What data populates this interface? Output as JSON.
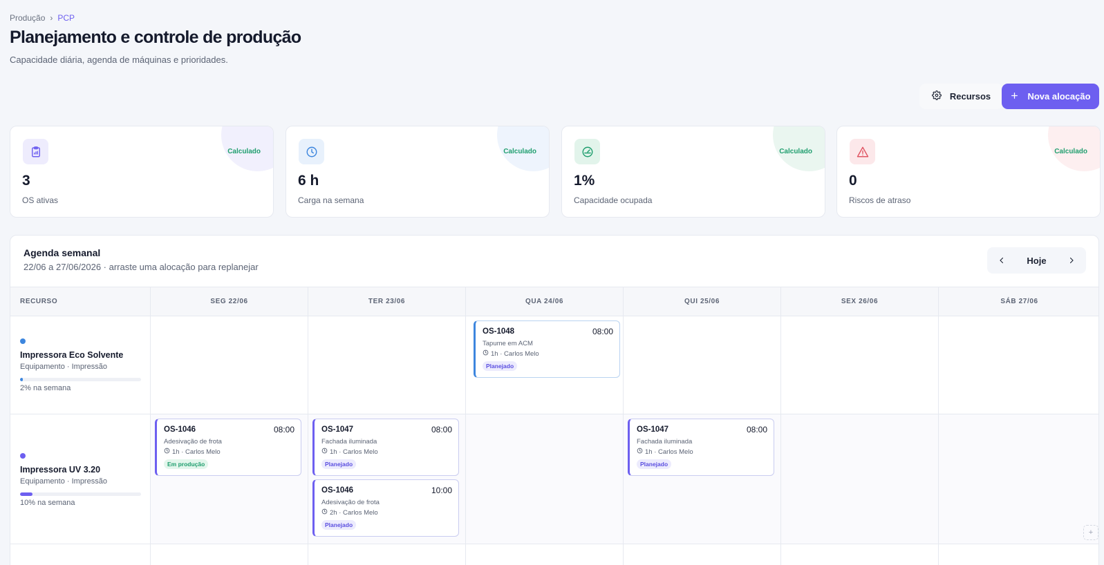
{
  "breadcrumb": {
    "root": "Produção",
    "separator": "›",
    "current": "PCP"
  },
  "header": {
    "title": "Planejamento e controle de produção",
    "subtitle": "Capacidade diária, agenda de máquinas e prioridades."
  },
  "actions": {
    "resources_label": "Recursos",
    "new_allocation_label": "Nova alocação",
    "resources_icon": "gear-icon",
    "new_icon": "plus-icon"
  },
  "kpis": [
    {
      "icon": "clipboard-icon",
      "tag": "Calculado",
      "value": "3",
      "label": "OS ativas",
      "color": "#6d5ff0"
    },
    {
      "icon": "clock-icon",
      "tag": "Calculado",
      "value": "6 h",
      "label": "Carga na semana",
      "color": "#3d86de"
    },
    {
      "icon": "gauge-icon",
      "tag": "Calculado",
      "value": "1%",
      "label": "Capacidade ocupada",
      "color": "#1f9e6e"
    },
    {
      "icon": "warning-icon",
      "tag": "Calculado",
      "value": "0",
      "label": "Riscos de atraso",
      "color": "#e05563"
    }
  ],
  "agenda": {
    "title": "Agenda semanal",
    "subtitle": "22/06 a 27/06/2026 · arraste uma alocação para replanejar",
    "today_label": "Hoje",
    "columns": [
      "RECURSO",
      "SEG 22/06",
      "TER 23/06",
      "QUA 24/06",
      "QUI 25/06",
      "SEX 26/06",
      "SÁB 27/06"
    ],
    "resources": [
      {
        "name": "Impressora Eco Solvente",
        "type": "Equipamento · Impressão",
        "load_label": "2% na semana",
        "load": 0.02,
        "color": "#3d86de"
      },
      {
        "name": "Impressora UV 3.20",
        "type": "Equipamento · Impressão",
        "load_label": "10% na semana",
        "load": 0.1,
        "color": "#6d5ff0"
      }
    ],
    "cards": [
      {
        "os": "OS-1048",
        "time": "08:00",
        "desc": "Tapume em ACM",
        "meta": "1h · Carlos Melo",
        "badge": "Planejado"
      },
      {
        "os": "OS-1046",
        "time": "08:00",
        "desc": "Adesivação de frota",
        "meta": "1h · Carlos Melo",
        "badge": "Em produção"
      },
      {
        "os": "OS-1047",
        "time": "08:00",
        "desc": "Fachada iluminada",
        "meta": "1h · Carlos Melo",
        "badge": "Planejado"
      },
      {
        "os": "OS-1046",
        "time": "10:00",
        "desc": "Adesivação de frota",
        "meta": "2h · Carlos Melo",
        "badge": "Planejado"
      },
      {
        "os": "OS-1047",
        "time": "08:00",
        "desc": "Fachada iluminada",
        "meta": "1h · Carlos Melo",
        "badge": "Planejado"
      }
    ],
    "add_label": "+"
  }
}
